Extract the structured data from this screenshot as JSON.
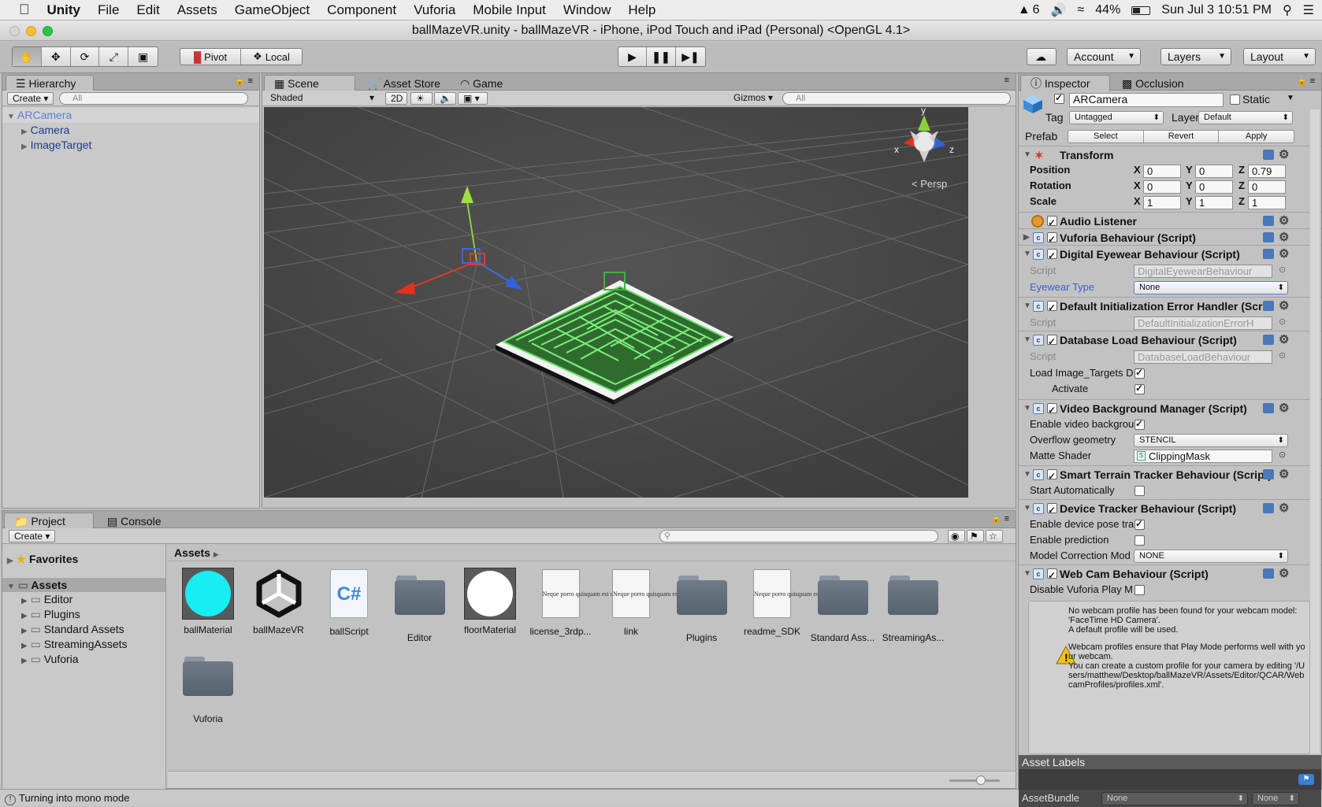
{
  "menubar": {
    "app": "Unity",
    "items": [
      "File",
      "Edit",
      "Assets",
      "GameObject",
      "Component",
      "Vuforia",
      "Mobile Input",
      "Window",
      "Help"
    ],
    "status": {
      "adobe": "6",
      "battery": "44%",
      "datetime": "Sun Jul 3  10:51 PM"
    }
  },
  "window": {
    "title": "ballMazeVR.unity - ballMazeVR - iPhone, iPod Touch and iPad (Personal) <OpenGL 4.1>"
  },
  "toolbar": {
    "pivot": "Pivot",
    "local": "Local",
    "account": "Account",
    "layers": "Layers",
    "layout": "Layout"
  },
  "hierarchy": {
    "tab": "Hierarchy",
    "create": "Create",
    "search_placeholder": "All",
    "items": [
      "ARCamera",
      "Camera",
      "ImageTarget"
    ]
  },
  "scene": {
    "tabs": [
      "Scene",
      "Asset Store",
      "Game"
    ],
    "shading": "Shaded",
    "mode2d": "2D",
    "gizmos": "Gizmos",
    "search_placeholder": "All",
    "gizmo_labels": {
      "y": "y",
      "x": "x",
      "z": "z",
      "persp": "Persp"
    }
  },
  "project": {
    "tabs": [
      "Project",
      "Console"
    ],
    "create": "Create",
    "favorites": "Favorites",
    "assets_root": "Assets",
    "tree": [
      "Editor",
      "Plugins",
      "Standard Assets",
      "StreamingAssets",
      "Vuforia"
    ],
    "breadcrumb": "Assets",
    "assets": [
      {
        "name": "ballMaterial",
        "kind": "material-cyan"
      },
      {
        "name": "ballMazeVR",
        "kind": "unity-scene"
      },
      {
        "name": "ballScript",
        "kind": "csharp",
        "glyph": "C#"
      },
      {
        "name": "Editor",
        "kind": "folder"
      },
      {
        "name": "floorMaterial",
        "kind": "material-white"
      },
      {
        "name": "license_3rdp...",
        "kind": "document"
      },
      {
        "name": "link",
        "kind": "document"
      },
      {
        "name": "Plugins",
        "kind": "folder"
      },
      {
        "name": "readme_SDK",
        "kind": "document"
      },
      {
        "name": "Standard Ass...",
        "kind": "folder"
      },
      {
        "name": "StreamingAs...",
        "kind": "folder"
      },
      {
        "name": "Vuforia",
        "kind": "folder"
      }
    ],
    "doc_text": "Neque porro quisquam est qui dolorem."
  },
  "status_bar": "Turning into mono mode",
  "inspector": {
    "tabs": [
      "Inspector",
      "Occlusion"
    ],
    "object_name": "ARCamera",
    "static_label": "Static",
    "tag_label": "Tag",
    "tag_value": "Untagged",
    "layer_label": "Layer",
    "layer_value": "Default",
    "prefab_label": "Prefab",
    "prefab_buttons": [
      "Select",
      "Revert",
      "Apply"
    ],
    "transform": {
      "title": "Transform",
      "rows": [
        {
          "label": "Position",
          "x": "0",
          "y": "0",
          "z": "0.79"
        },
        {
          "label": "Rotation",
          "x": "0",
          "y": "0",
          "z": "0"
        },
        {
          "label": "Scale",
          "x": "1",
          "y": "1",
          "z": "1"
        }
      ]
    },
    "components": {
      "audio": "Audio Listener",
      "vuforia": "Vuforia Behaviour (Script)",
      "eyewear": "Digital Eyewear Behaviour (Script)",
      "eyewear_script": "DigitalEyewearBehaviour",
      "eyewear_type_label": "Eyewear Type",
      "eyewear_type": "None",
      "init_err": "Default Initialization Error Handler (Scri",
      "init_err_script": "DefaultInitializationErrorH",
      "dbload": "Database Load Behaviour (Script)",
      "dbload_script": "DatabaseLoadBehaviour",
      "load_targets": "Load Image_Targets D",
      "activate": "Activate",
      "videobg": "Video Background Manager (Script)",
      "enable_video": "Enable video backgrou",
      "overflow_label": "Overflow geometry",
      "overflow": "STENCIL",
      "matte_label": "Matte Shader",
      "matte": "ClippingMask",
      "terrain": "Smart Terrain Tracker Behaviour (Script)",
      "start_auto": "Start Automatically",
      "device": "Device Tracker Behaviour (Script)",
      "pose": "Enable device pose tra",
      "prediction": "Enable prediction",
      "model_corr_label": "Model Correction Mod",
      "model_corr": "NONE",
      "webcam": "Web Cam Behaviour (Script)",
      "disable_play": "Disable Vuforia Play M",
      "script_label": "Script"
    },
    "webcam_msg1": "No webcam profile has been found for your webcam model: 'FaceTime HD Camera'.\nA default profile will be used.",
    "webcam_msg2": "Webcam profiles ensure that Play Mode performs well with your webcam.\nYou can create a custom profile for your camera by editing '/Users/matthew/Desktop/ballMazeVR/Assets/Editor/QCAR/WebcamProfiles/profiles.xml'.",
    "asset_labels": "Asset Labels",
    "assetbundle_label": "AssetBundle",
    "assetbundle_value": "None",
    "assetbundle_variant": "None"
  }
}
